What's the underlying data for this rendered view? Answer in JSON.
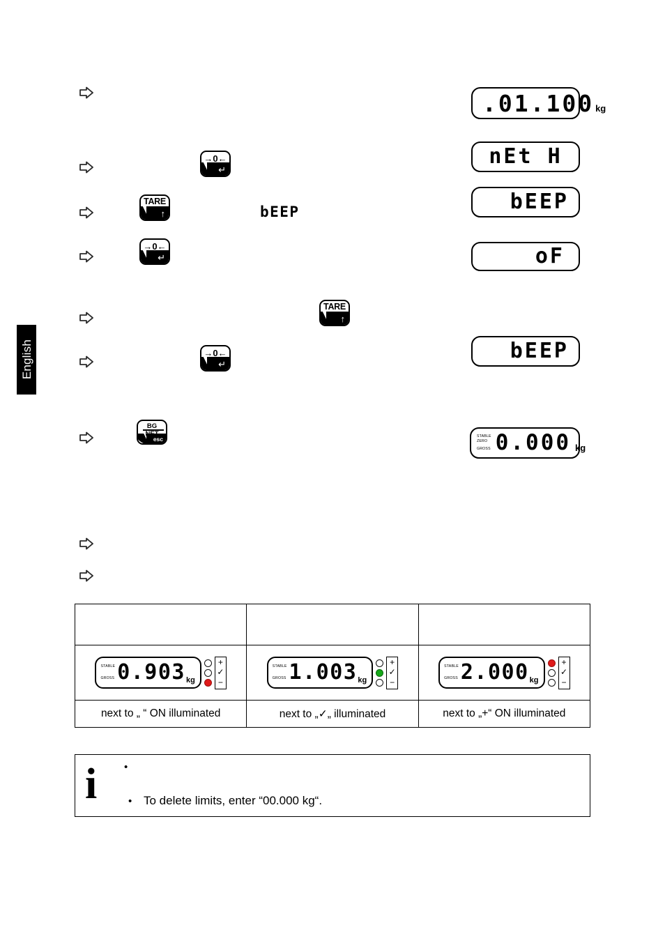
{
  "page": {
    "language_tab": "English"
  },
  "steps": [
    {
      "name": "step-1",
      "arrow": "⇨",
      "key": null,
      "mid_label": null,
      "display": ".01.100",
      "unit": "kg"
    },
    {
      "name": "step-2",
      "arrow": "⇨",
      "key": "zero-enter",
      "mid_label": null,
      "display": "nEt H",
      "unit": ""
    },
    {
      "name": "step-3",
      "arrow": "⇨",
      "key": "tare-up",
      "mid_label": "bEEP",
      "display": "bEEP",
      "unit": ""
    },
    {
      "name": "step-4",
      "arrow": "⇨",
      "key": "zero-enter",
      "mid_label": null,
      "display": "oF",
      "unit": ""
    },
    {
      "name": "step-5",
      "arrow": "⇨",
      "key": "tare-up",
      "mid_label": null,
      "display": null,
      "unit": ""
    },
    {
      "name": "step-6",
      "arrow": "⇨",
      "key": "zero-enter",
      "mid_label": null,
      "display": "bEEP",
      "unit": ""
    },
    {
      "name": "step-7",
      "arrow": "⇨",
      "key": "bg-net-esc",
      "mid_label": null,
      "display": "0.000",
      "unit": "kg"
    },
    {
      "name": "step-8",
      "arrow": "⇨",
      "key": null,
      "mid_label": null,
      "display": null,
      "unit": ""
    },
    {
      "name": "step-9",
      "arrow": "⇨",
      "key": null,
      "mid_label": null,
      "display": null,
      "unit": ""
    }
  ],
  "keys": {
    "zero_enter": {
      "top": "→0←",
      "glyph": "↵"
    },
    "tare_up": {
      "top": "TARE",
      "glyph": "↑"
    },
    "bg_net_esc": {
      "bg": "BG",
      "net": "NET",
      "esc": "esc"
    }
  },
  "display_flags": {
    "stable": "STABLE",
    "zero": "ZERO",
    "gross": "GROSS"
  },
  "results_table": {
    "header": [
      "",
      "",
      ""
    ],
    "rows": [
      {
        "name": "result-under",
        "value": "0.903",
        "unit": "kg",
        "flags": [
          "STABLE",
          "GROSS"
        ],
        "leds": [
          "off",
          "off",
          "red"
        ],
        "symbols": [
          "+",
          "✓",
          "−"
        ],
        "caption": "next to „ “ ON illuminated"
      },
      {
        "name": "result-ok",
        "value": "1.003",
        "unit": "kg",
        "flags": [
          "STABLE",
          "GROSS"
        ],
        "leds": [
          "off",
          "green",
          "off"
        ],
        "symbols": [
          "+",
          "✓",
          "−"
        ],
        "caption": "next to „✓„ illuminated"
      },
      {
        "name": "result-over",
        "value": "2.000",
        "unit": "kg",
        "flags": [
          "STABLE",
          "GROSS"
        ],
        "leds": [
          "red",
          "off",
          "off"
        ],
        "symbols": [
          "+",
          "✓",
          "−"
        ],
        "caption": "next to „+“ ON illuminated"
      }
    ]
  },
  "note": {
    "icon": "i",
    "items": [
      "",
      "To delete limits, enter “00.000 kg“."
    ]
  },
  "colors": {
    "led_red": "#e01b1b",
    "led_green": "#17a81a",
    "ink": "#000000",
    "tab_bg": "#000000",
    "tab_text": "#ffffff"
  }
}
